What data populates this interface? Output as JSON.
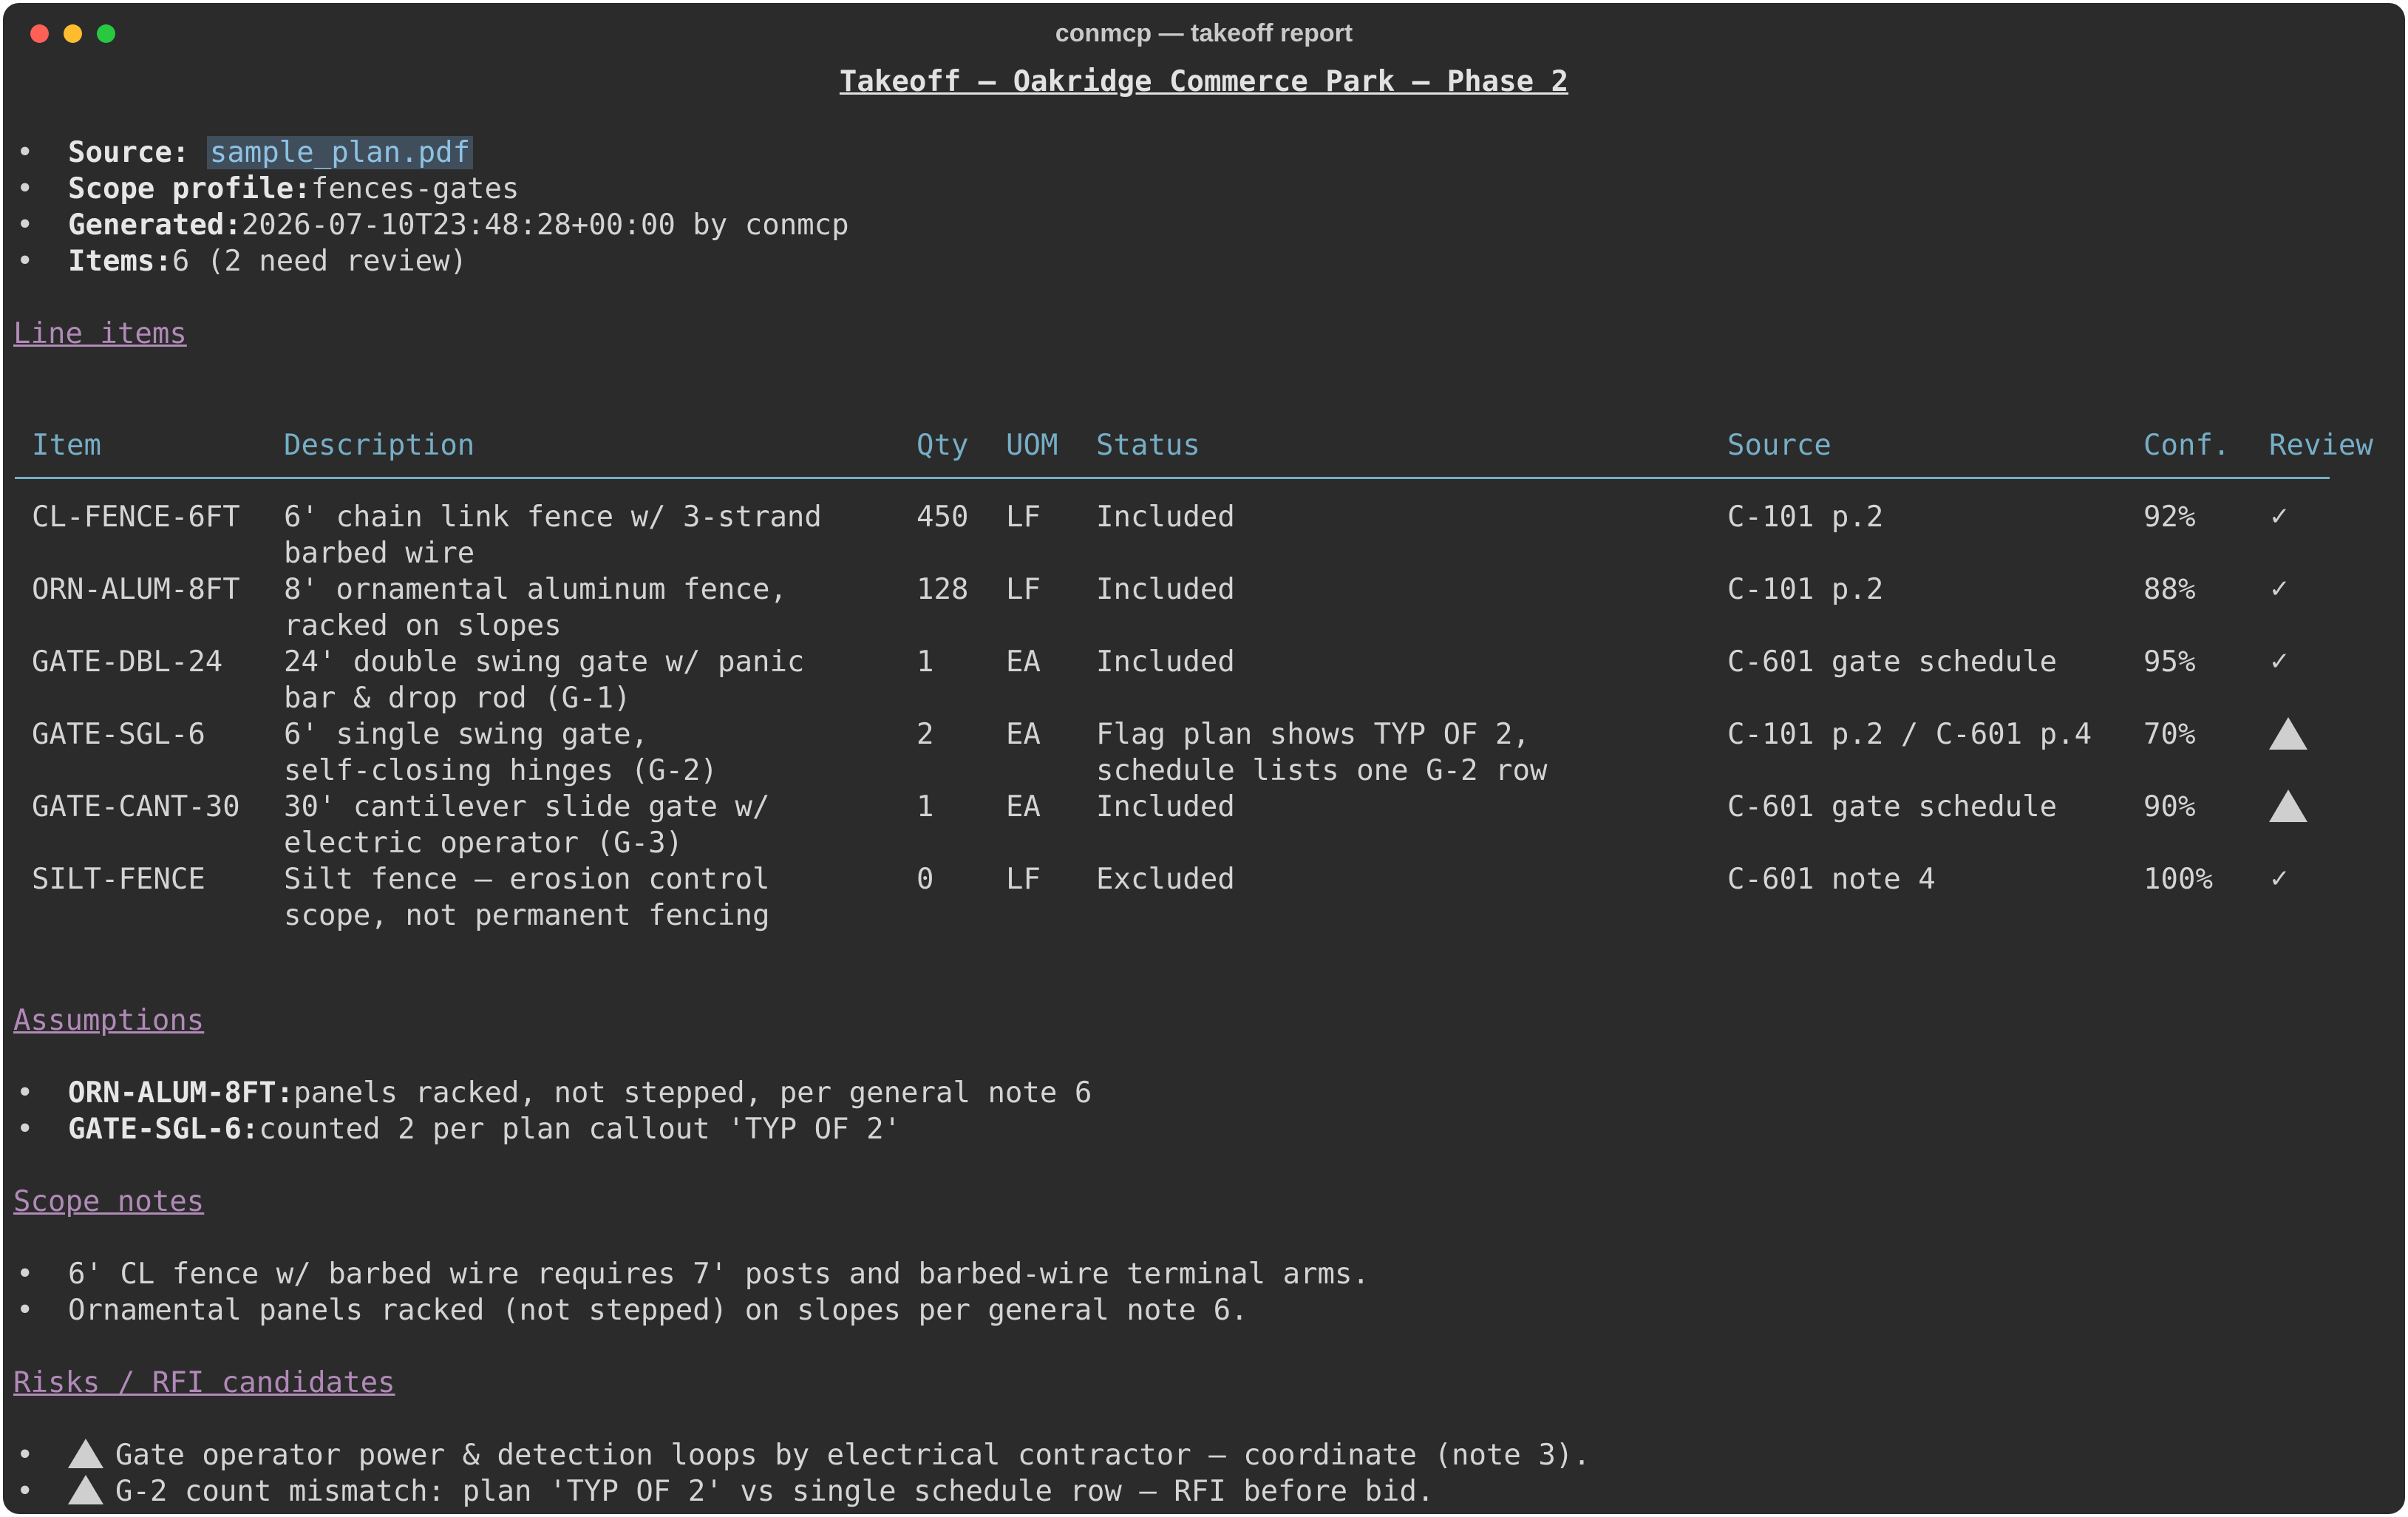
{
  "window": {
    "title": "conmcp — takeoff report"
  },
  "report": {
    "title": "Takeoff — Oakridge Commerce Park — Phase 2"
  },
  "meta": {
    "source_label": "Source: ",
    "source_value": "sample_plan.pdf",
    "scope_label": "Scope profile:",
    "scope_value": "fences-gates",
    "generated_label": "Generated:",
    "generated_value": "2026-07-10T23:48:28+00:00 by conmcp",
    "items_label": "Items:",
    "items_value": "6 (2 need review)"
  },
  "sections": {
    "line_items": "Line items",
    "assumptions": "Assumptions",
    "scope_notes": "Scope notes",
    "risks": "Risks / RFI candidates"
  },
  "table": {
    "headers": {
      "item": "Item",
      "description": "Description",
      "qty": "Qty",
      "uom": "UOM",
      "status": "Status",
      "source": "Source",
      "conf": "Conf.",
      "review": "Review"
    },
    "rows": [
      {
        "item": "CL-FENCE-6FT",
        "desc1": "6' chain link fence w/ 3-strand",
        "desc2": "barbed wire",
        "qty": "450",
        "uom": "LF",
        "status1": "Included",
        "status2": "",
        "source": "C-101 p.2",
        "conf": "92%",
        "review": "✓",
        "review_icon": "check-icon"
      },
      {
        "item": "ORN-ALUM-8FT",
        "desc1": "8' ornamental aluminum fence,",
        "desc2": "racked on slopes",
        "qty": "128",
        "uom": "LF",
        "status1": "Included",
        "status2": "",
        "source": "C-101 p.2",
        "conf": "88%",
        "review": "✓",
        "review_icon": "check-icon"
      },
      {
        "item": "GATE-DBL-24",
        "desc1": "24' double swing gate w/ panic",
        "desc2": "bar & drop rod (G-1)",
        "qty": "1",
        "uom": "EA",
        "status1": "Included",
        "status2": "",
        "source": "C-601 gate schedule",
        "conf": "95%",
        "review": "✓",
        "review_icon": "check-icon"
      },
      {
        "item": "GATE-SGL-6",
        "desc1": "6' single swing gate,",
        "desc2": "self-closing hinges (G-2)",
        "qty": "2",
        "uom": "EA",
        "status1": "Flag plan shows TYP OF 2,",
        "status2": "schedule lists one G-2 row",
        "source": "C-101 p.2 / C-601 p.4",
        "conf": "70%",
        "review": "",
        "review_icon": "warning-icon"
      },
      {
        "item": "GATE-CANT-30",
        "desc1": "30' cantilever slide gate w/",
        "desc2": "electric operator (G-3)",
        "qty": "1",
        "uom": "EA",
        "status1": "Included",
        "status2": "",
        "source": "C-601 gate schedule",
        "conf": "90%",
        "review": "",
        "review_icon": "warning-icon"
      },
      {
        "item": "SILT-FENCE",
        "desc1": "Silt fence — erosion control",
        "desc2": "scope, not permanent fencing",
        "qty": "0",
        "uom": "LF",
        "status1": "Excluded",
        "status2": "",
        "source": "C-601 note 4",
        "conf": "100%",
        "review": "✓",
        "review_icon": "check-icon"
      }
    ]
  },
  "assumptions": [
    {
      "key": "ORN-ALUM-8FT:",
      "text": "panels racked, not stepped, per general note 6"
    },
    {
      "key": "GATE-SGL-6:",
      "text": "counted 2 per plan callout 'TYP OF 2'"
    }
  ],
  "scope_notes": [
    "6' CL fence w/ barbed wire requires 7' posts and barbed-wire terminal arms.",
    "Ornamental panels racked (not stepped) on slopes per general note 6."
  ],
  "risks": [
    {
      "icon": "warning-icon",
      "text": "Gate operator power & detection loops by electrical contractor — coordinate (note 3)."
    },
    {
      "icon": "warning-icon",
      "text": "G-2 count mismatch: plan 'TYP OF 2' vs single schedule row — RFI before bid."
    }
  ],
  "bullet_glyph": "•"
}
